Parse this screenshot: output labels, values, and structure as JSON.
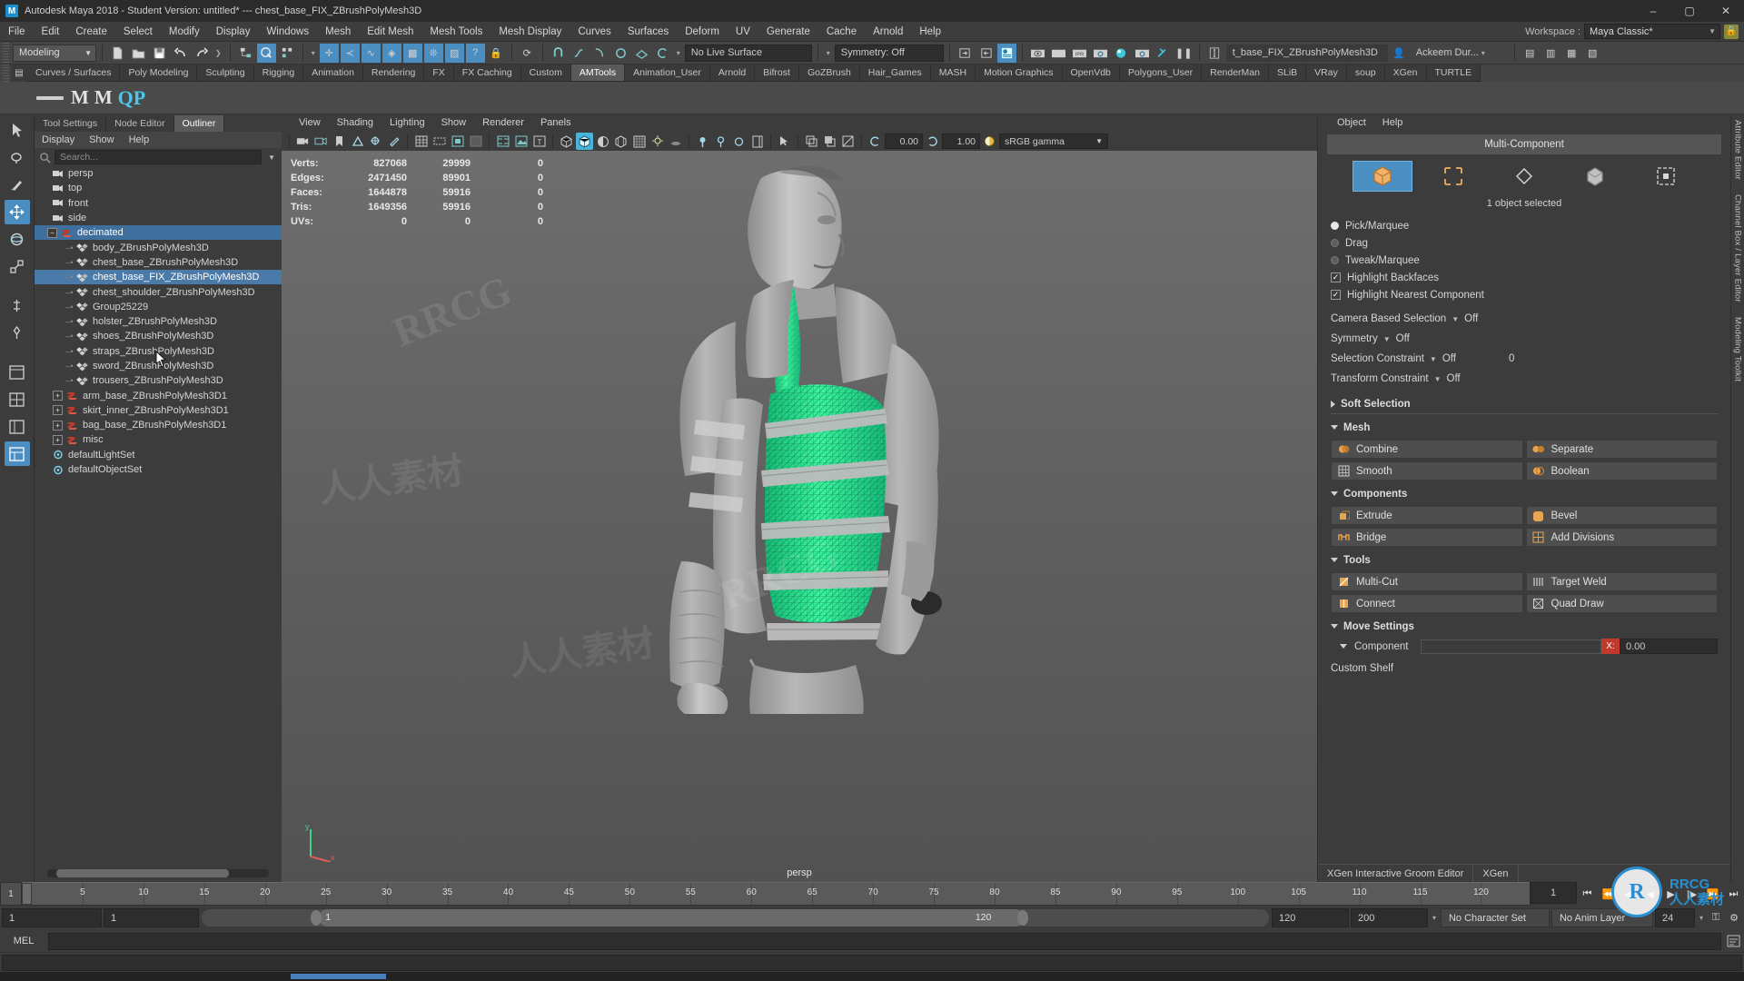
{
  "titlebar": {
    "app_icon": "maya-logo-icon",
    "title": "Autodesk Maya 2018 - Student Version: untitled*   ---   chest_base_FIX_ZBrushPolyMesh3D",
    "minimize": "–",
    "maximize": "▢",
    "close": "✕"
  },
  "menubar": {
    "items": [
      "File",
      "Edit",
      "Create",
      "Select",
      "Modify",
      "Display",
      "Windows",
      "Mesh",
      "Edit Mesh",
      "Mesh Tools",
      "Mesh Display",
      "Curves",
      "Surfaces",
      "Deform",
      "UV",
      "Generate",
      "Cache",
      "Arnold",
      "Help"
    ],
    "workspace_label": "Workspace :",
    "workspace_value": "Maya Classic*",
    "lock_icon": "lock-icon"
  },
  "statusbar": {
    "menuset": "Modeling",
    "live_surface": "No Live Surface",
    "symmetry": "Symmetry: Off",
    "selection_field": "t_base_FIX_ZBrushPolyMesh3D",
    "user_name": "Ackeem Dur...",
    "icons": [
      "new-scene-icon",
      "open-scene-icon",
      "save-scene-icon",
      "undo-icon",
      "redo-icon",
      "select-by-hierarchy-icon",
      "select-by-object-icon",
      "select-by-component-icon",
      "snap-to-grid-icon",
      "snap-to-curve-icon",
      "snap-to-point-icon",
      "snap-to-projected-center-icon",
      "snap-to-view-plane-icon",
      "make-live-icon",
      "render-current-frame-icon",
      "ipr-render-icon",
      "render-settings-icon",
      "hypershade-icon",
      "render-view-icon",
      "render-sequence-icon",
      "pause-icon",
      "text-cursor-icon"
    ]
  },
  "shelf": {
    "tabs": [
      "Curves / Surfaces",
      "Poly Modeling",
      "Sculpting",
      "Rigging",
      "Animation",
      "Rendering",
      "FX",
      "FX Caching",
      "Custom",
      "AMTools",
      "Animation_User",
      "Arnold",
      "Bifrost",
      "GoZBrush",
      "Hair_Games",
      "MASH",
      "Motion Graphics",
      "OpenVdb",
      "Polygons_User",
      "RenderMan",
      "SLiB",
      "VRay",
      "soup",
      "XGen",
      "TURTLE"
    ],
    "active_tab": "AMTools",
    "items": [
      "divider-icon",
      "m-tool-icon",
      "m-tool-icon-2",
      "qp-tool-icon"
    ]
  },
  "toolbox": {
    "tools": [
      {
        "name": "select-tool",
        "glyph": "➤"
      },
      {
        "name": "lasso-select-tool",
        "glyph": "❧"
      },
      {
        "name": "paint-select-tool",
        "glyph": "✎"
      },
      {
        "name": "move-tool",
        "glyph": "✥"
      },
      {
        "name": "rotate-tool",
        "glyph": "◈"
      },
      {
        "name": "scale-tool",
        "glyph": "⬚"
      },
      {
        "name": "last-tool",
        "glyph": "⌖"
      },
      {
        "name": "snap-tool",
        "glyph": "❖"
      },
      {
        "name": "layout-single-icon",
        "glyph": "▥"
      },
      {
        "name": "layout-four-icon",
        "glyph": "⊞"
      },
      {
        "name": "layout-outliner-icon",
        "glyph": "▤"
      },
      {
        "name": "layout-hypergraph-icon",
        "glyph": "▦"
      }
    ]
  },
  "outliner": {
    "tabs": [
      "Tool Settings",
      "Node Editor",
      "Outliner"
    ],
    "active_tab": "Outliner",
    "menu": [
      "Display",
      "Show",
      "Help"
    ],
    "search_placeholder": "Search...",
    "search_icon": "search-icon",
    "nodes": [
      {
        "label": "persp",
        "icon": "camera-icon",
        "indent": 1,
        "type": "camera"
      },
      {
        "label": "top",
        "icon": "camera-icon",
        "indent": 1,
        "type": "camera"
      },
      {
        "label": "front",
        "icon": "camera-icon",
        "indent": 1,
        "type": "camera"
      },
      {
        "label": "side",
        "icon": "camera-icon",
        "indent": 1,
        "type": "camera"
      },
      {
        "label": "decimated",
        "icon": "group-icon",
        "indent": 0,
        "type": "group",
        "selected": true,
        "expanded": true
      },
      {
        "label": "body_ZBrushPolyMesh3D",
        "icon": "mesh-icon",
        "indent": 2,
        "type": "mesh"
      },
      {
        "label": "chest_base_ZBrushPolyMesh3D",
        "icon": "mesh-icon",
        "indent": 2,
        "type": "mesh"
      },
      {
        "label": "chest_base_FIX_ZBrushPolyMesh3D",
        "icon": "mesh-icon",
        "indent": 2,
        "type": "mesh",
        "selected": true
      },
      {
        "label": "chest_shoulder_ZBrushPolyMesh3D",
        "icon": "mesh-icon",
        "indent": 2,
        "type": "mesh"
      },
      {
        "label": "Group25229",
        "icon": "mesh-icon",
        "indent": 2,
        "type": "mesh"
      },
      {
        "label": "holster_ZBrushPolyMesh3D",
        "icon": "mesh-icon",
        "indent": 2,
        "type": "mesh"
      },
      {
        "label": "shoes_ZBrushPolyMesh3D",
        "icon": "mesh-icon",
        "indent": 2,
        "type": "mesh"
      },
      {
        "label": "straps_ZBrushPolyMesh3D",
        "icon": "mesh-icon",
        "indent": 2,
        "type": "mesh"
      },
      {
        "label": "sword_ZBrushPolyMesh3D",
        "icon": "mesh-icon",
        "indent": 2,
        "type": "mesh"
      },
      {
        "label": "trousers_ZBrushPolyMesh3D",
        "icon": "mesh-icon",
        "indent": 2,
        "type": "mesh"
      },
      {
        "label": "arm_base_ZBrushPolyMesh3D1",
        "icon": "group-icon",
        "indent": 1,
        "type": "group",
        "collapsed": true
      },
      {
        "label": "skirt_inner_ZBrushPolyMesh3D1",
        "icon": "group-icon",
        "indent": 1,
        "type": "group",
        "collapsed": true
      },
      {
        "label": "bag_base_ZBrushPolyMesh3D1",
        "icon": "group-icon",
        "indent": 1,
        "type": "group",
        "collapsed": true
      },
      {
        "label": "misc",
        "icon": "group-icon",
        "indent": 1,
        "type": "group",
        "collapsed": true
      },
      {
        "label": "defaultLightSet",
        "icon": "set-icon",
        "indent": 1,
        "type": "set"
      },
      {
        "label": "defaultObjectSet",
        "icon": "set-icon",
        "indent": 1,
        "type": "set"
      }
    ]
  },
  "viewport": {
    "menu": [
      "View",
      "Shading",
      "Lighting",
      "Show",
      "Renderer",
      "Panels"
    ],
    "exposure_value": "0.00",
    "gamma_value": "1.00",
    "color_space": "sRGB gamma",
    "camera_label": "persp",
    "axis_labels": {
      "y": "y",
      "x": "x"
    },
    "hud": {
      "rows": [
        {
          "label": "Verts:",
          "c1": "827068",
          "c2": "29999",
          "c3": "0"
        },
        {
          "label": "Edges:",
          "c1": "2471450",
          "c2": "89901",
          "c3": "0"
        },
        {
          "label": "Faces:",
          "c1": "1644878",
          "c2": "59916",
          "c3": "0"
        },
        {
          "label": "Tris:",
          "c1": "1649356",
          "c2": "59916",
          "c3": "0"
        },
        {
          "label": "UVs:",
          "c1": "0",
          "c2": "0",
          "c3": "0"
        }
      ]
    }
  },
  "modeling_toolkit": {
    "menu": [
      "Object",
      "Help"
    ],
    "header": "Multi-Component",
    "mode_buttons": [
      "object-mode-icon",
      "multi-component-icon",
      "vertex-mode-icon",
      "edge-mode-icon",
      "face-mode-icon"
    ],
    "selection_info": "1 object selected",
    "radios": [
      {
        "label": "Pick/Marquee",
        "on": true
      },
      {
        "label": "Drag",
        "on": false
      },
      {
        "label": "Tweak/Marquee",
        "on": false
      }
    ],
    "checks": [
      {
        "label": "Highlight Backfaces",
        "on": true
      },
      {
        "label": "Highlight Nearest Component",
        "on": true
      }
    ],
    "dropdowns": [
      {
        "label": "Camera Based Selection",
        "value": "Off"
      },
      {
        "label": "Symmetry",
        "value": "Off"
      },
      {
        "label": "Selection Constraint",
        "value": "Off",
        "extra": "0"
      },
      {
        "label": "Transform Constraint",
        "value": "Off"
      }
    ],
    "soft_selection": "Soft Selection",
    "sections": [
      {
        "title": "Mesh",
        "buttons": [
          {
            "label": "Combine",
            "icon": "combine-icon"
          },
          {
            "label": "Separate",
            "icon": "separate-icon"
          },
          {
            "label": "Smooth",
            "icon": "smooth-icon"
          },
          {
            "label": "Boolean",
            "icon": "boolean-icon"
          }
        ]
      },
      {
        "title": "Components",
        "buttons": [
          {
            "label": "Extrude",
            "icon": "extrude-icon"
          },
          {
            "label": "Bevel",
            "icon": "bevel-icon"
          },
          {
            "label": "Bridge",
            "icon": "bridge-icon"
          },
          {
            "label": "Add Divisions",
            "icon": "add-divisions-icon"
          }
        ]
      },
      {
        "title": "Tools",
        "buttons": [
          {
            "label": "Multi-Cut",
            "icon": "multi-cut-icon"
          },
          {
            "label": "Target Weld",
            "icon": "target-weld-icon"
          },
          {
            "label": "Connect",
            "icon": "connect-icon"
          },
          {
            "label": "Quad Draw",
            "icon": "quad-draw-icon"
          }
        ]
      }
    ],
    "move_settings": {
      "title": "Move Settings",
      "component_label": "Component",
      "axis_label": "X:",
      "axis_value": "0.00"
    },
    "custom_shelf": "Custom Shelf",
    "bottom_tabs": [
      "XGen Interactive Groom Editor",
      "XGen"
    ]
  },
  "right_vtabs": [
    "Attribute Editor",
    "Channel Box / Layer Editor",
    "Modeling Toolkit"
  ],
  "timeline": {
    "start_field": "1",
    "current_frame": "1",
    "ticks": [
      5,
      10,
      15,
      20,
      25,
      30,
      35,
      40,
      45,
      50,
      55,
      60,
      65,
      70,
      75,
      80,
      85,
      90,
      95,
      100,
      105,
      110,
      115,
      120
    ],
    "end_field": "120",
    "range_start": "1",
    "range_inner_start": "1",
    "range_inner_end": "120",
    "range_end": "120",
    "playback_end": "200",
    "character_set": "No Character Set",
    "anim_layer": "No Anim Layer",
    "extra_value": "24",
    "transport_icons": [
      "go-to-start-icon",
      "step-back-key-icon",
      "step-back-frame-icon",
      "play-backwards-icon",
      "play-forwards-icon",
      "step-forward-frame-icon",
      "step-forward-key-icon",
      "go-to-end-icon"
    ]
  },
  "command_line": {
    "mel_label": "MEL",
    "mel_value": "",
    "script_editor_icon": "script-editor-icon"
  },
  "watermarks": {
    "brand": "RRCG",
    "cn": "人人素材",
    "logo_letters": "R",
    "logo_text_line1": "RRCG",
    "logo_text_line2": "人人素材"
  },
  "colors": {
    "accent": "#4a8ec2",
    "highlight_green": "#2fe08f",
    "panel_bg": "#3c3c3c",
    "toolbar_bg": "#444444",
    "title_bg": "#2b2b2b",
    "selection_blue": "#4a7aa8",
    "viewport_top": "#6e6e6e",
    "viewport_bottom": "#525252"
  }
}
